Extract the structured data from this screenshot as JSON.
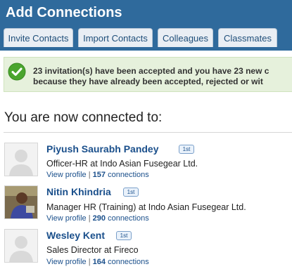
{
  "header": {
    "title": "Add Connections"
  },
  "tabs": [
    {
      "label": "Invite Contacts"
    },
    {
      "label": "Import Contacts"
    },
    {
      "label": "Colleagues"
    },
    {
      "label": "Classmates"
    }
  ],
  "notice": {
    "line1": "23 invitation(s) have been accepted and you have 23 new c",
    "line2": "because they have already been accepted, rejected or wit"
  },
  "section": {
    "title": "You are now connected to:"
  },
  "connections": [
    {
      "name": "Piyush Saurabh Pandey",
      "degree": "1st",
      "title": "Officer-HR at Indo Asian Fusegear Ltd.",
      "view_profile": "View profile",
      "separator": "|",
      "count": "157",
      "count_label": "connections"
    },
    {
      "name": "Nitin Khindria",
      "degree": "1st",
      "title": "Manager HR (Training) at Indo Asian Fusegear Ltd.",
      "view_profile": "View profile",
      "separator": "|",
      "count": "290",
      "count_label": "connections"
    },
    {
      "name": "Wesley Kent",
      "degree": "1st",
      "title": "Sales Director at Fireco",
      "view_profile": "View profile",
      "separator": "|",
      "count": "164",
      "count_label": "connections"
    }
  ],
  "colors": {
    "header_bg": "#2f6a9c",
    "link": "#1a4f8b",
    "success_bg": "#e6f1dc",
    "success_icon": "#4aa52e"
  }
}
